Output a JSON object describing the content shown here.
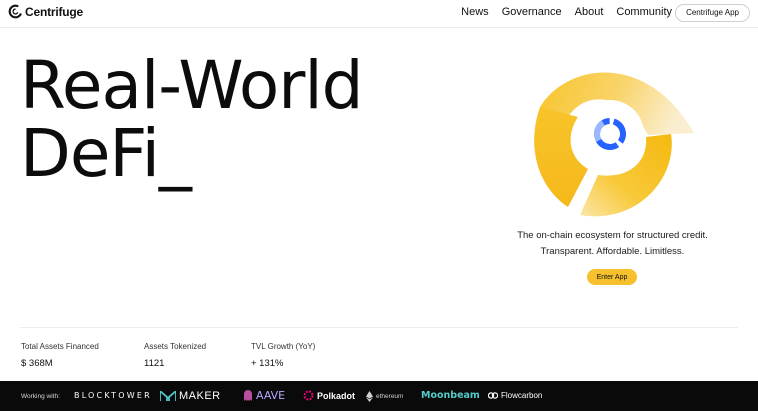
{
  "header": {
    "brand": "Centrifuge",
    "nav": [
      {
        "label": "News"
      },
      {
        "label": "Governance"
      },
      {
        "label": "About"
      },
      {
        "label": "Community"
      }
    ],
    "app_button": "Centrifuge App"
  },
  "hero": {
    "title_line1": "Real-World",
    "title_line2": "DeFi_",
    "tagline_line1": "The on-chain ecosystem for structured credit.",
    "tagline_line2": "Transparent. Affordable. Limitless.",
    "cta": "Enter App"
  },
  "stats": [
    {
      "label": "Total Assets Financed",
      "value": "$ 368M"
    },
    {
      "label": "Assets Tokenized",
      "value": "1121"
    },
    {
      "label": "TVL Growth (YoY)",
      "value": "+ 131%"
    }
  ],
  "partners": {
    "intro": "Working with:",
    "logos": [
      {
        "name": "BLOCKTOWER",
        "icon": "blocktower-logo"
      },
      {
        "name": "MAKER",
        "icon": "maker-logo"
      },
      {
        "name": "AAVE",
        "icon": "aave-logo"
      },
      {
        "name": "Polkadot",
        "icon": "polkadot-logo"
      },
      {
        "name": "ethereum",
        "icon": "ethereum-logo"
      },
      {
        "name": "Moonbeam",
        "icon": "moonbeam-logo"
      },
      {
        "name": "Flowcarbon",
        "icon": "flowcarbon-logo"
      }
    ]
  },
  "colors": {
    "accent_yellow": "#f6c12c",
    "ring_blue": "#2762ff",
    "partner_bar": "#0a0a0a",
    "moonbeam_teal": "#53cbc9",
    "polkadot_pink": "#e6007a"
  }
}
